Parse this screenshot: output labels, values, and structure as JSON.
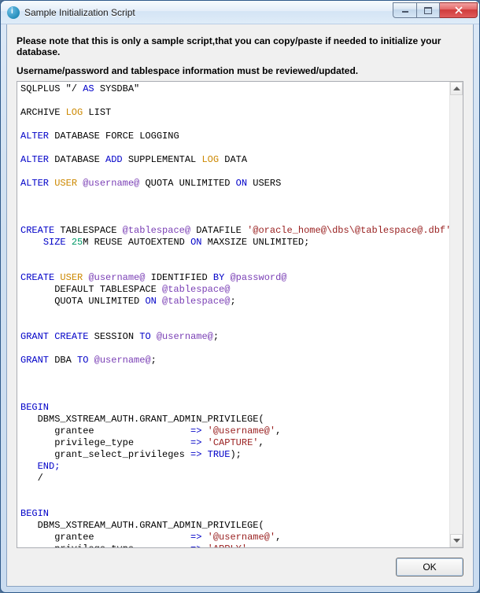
{
  "window": {
    "title": "Sample Initialization Script"
  },
  "notes": {
    "line1": "Please note that this is only a sample script,that you can copy/paste if needed to initialize your database.",
    "line2": "Username/password and tablespace information must be reviewed/updated."
  },
  "buttons": {
    "ok": "OK"
  },
  "script": {
    "l1": {
      "a": "SQLPLUS \"/ ",
      "b": "AS",
      "c": " SYSDBA\""
    },
    "l2": {
      "a": "ARCHIVE ",
      "b": "LOG",
      "c": " LIST"
    },
    "l3": {
      "a": "ALTER",
      "b": " DATABASE FORCE LOGGING"
    },
    "l4": {
      "a": "ALTER",
      "b": " DATABASE ",
      "c": "ADD",
      "d": " SUPPLEMENTAL ",
      "e": "LOG",
      "f": " DATA"
    },
    "l5": {
      "a": "ALTER",
      "b": " ",
      "c": "USER",
      "d": " ",
      "e": "@username@",
      "f": " QUOTA UNLIMITED ",
      "g": "ON",
      "h": " USERS"
    },
    "l6": {
      "a": "CREATE",
      "b": " TABLESPACE ",
      "c": "@tablespace@",
      "d": " DATAFILE ",
      "e": "'@oracle_home@\\dbs\\@tablespace@.dbf'"
    },
    "l6b": {
      "a": "    ",
      "b": "SIZE",
      "c": " ",
      "d": "25",
      "e": "M REUSE AUTOEXTEND ",
      "f": "ON",
      "g": " MAXSIZE UNLIMITED;"
    },
    "l7": {
      "a": "CREATE",
      "b": " ",
      "c": "USER",
      "d": " ",
      "e": "@username@",
      "f": " IDENTIFIED ",
      "g": "BY",
      "h": " ",
      "i": "@password@"
    },
    "l7b": {
      "a": "      DEFAULT TABLESPACE ",
      "b": "@tablespace@"
    },
    "l7c": {
      "a": "      QUOTA UNLIMITED ",
      "b": "ON",
      "c": " ",
      "d": "@tablespace@",
      "e": ";"
    },
    "l8": {
      "a": "GRANT",
      "b": " ",
      "c": "CREATE",
      "d": " SESSION ",
      "e": "TO",
      "f": " ",
      "g": "@username@",
      "h": ";"
    },
    "l9": {
      "a": "GRANT",
      "b": " DBA ",
      "c": "TO",
      "d": " ",
      "e": "@username@",
      "f": ";"
    },
    "beg": "BEGIN",
    "b1": "   DBMS_XSTREAM_AUTH.GRANT_ADMIN_PRIVILEGE(",
    "b2": {
      "a": "      grantee                 ",
      "b": "=>",
      "c": " ",
      "d": "'@username@'",
      "e": ","
    },
    "b3a": {
      "a": "      privilege_type          ",
      "b": "=>",
      "c": " ",
      "d": "'CAPTURE'",
      "e": ","
    },
    "b3b": {
      "a": "      privilege_type          ",
      "b": "=>",
      "c": " ",
      "d": "'APPLY'",
      "e": ","
    },
    "b4": {
      "a": "      grant_select_privileges ",
      "b": "=>",
      "c": " ",
      "d": "TRUE",
      "e": ");"
    },
    "end": "   END;",
    "slash": "   /"
  }
}
